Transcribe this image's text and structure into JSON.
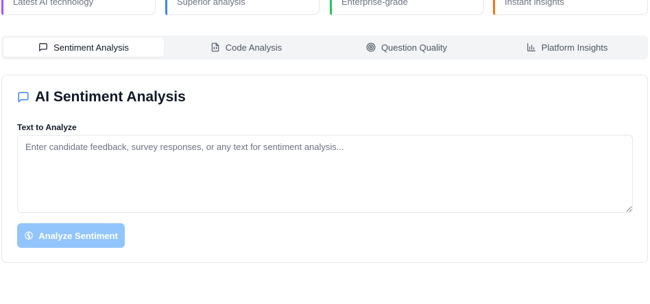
{
  "stats": [
    {
      "subtitle": "Latest AI technology",
      "accent": "#a855f7"
    },
    {
      "subtitle": "Superior analysis",
      "accent": "#3b82f6"
    },
    {
      "subtitle": "Enterprise-grade",
      "accent": "#22c55e"
    },
    {
      "subtitle": "Instant insights",
      "accent": "#f97316"
    }
  ],
  "tabs": [
    {
      "label": "Sentiment Analysis",
      "icon": "message-square-icon",
      "active": true
    },
    {
      "label": "Code Analysis",
      "icon": "file-code-icon",
      "active": false
    },
    {
      "label": "Question Quality",
      "icon": "target-icon",
      "active": false
    },
    {
      "label": "Platform Insights",
      "icon": "bar-chart-icon",
      "active": false
    }
  ],
  "panel": {
    "title": "AI Sentiment Analysis",
    "title_icon": "message-square-icon",
    "field_label": "Text to Analyze",
    "placeholder": "Enter candidate feedback, survey responses, or any text for sentiment analysis...",
    "value": "",
    "button_label": "Analyze Sentiment",
    "button_icon": "brain-icon"
  },
  "colors": {
    "accent_blue": "#3b82f6",
    "button_disabled": "#93c5fd"
  }
}
